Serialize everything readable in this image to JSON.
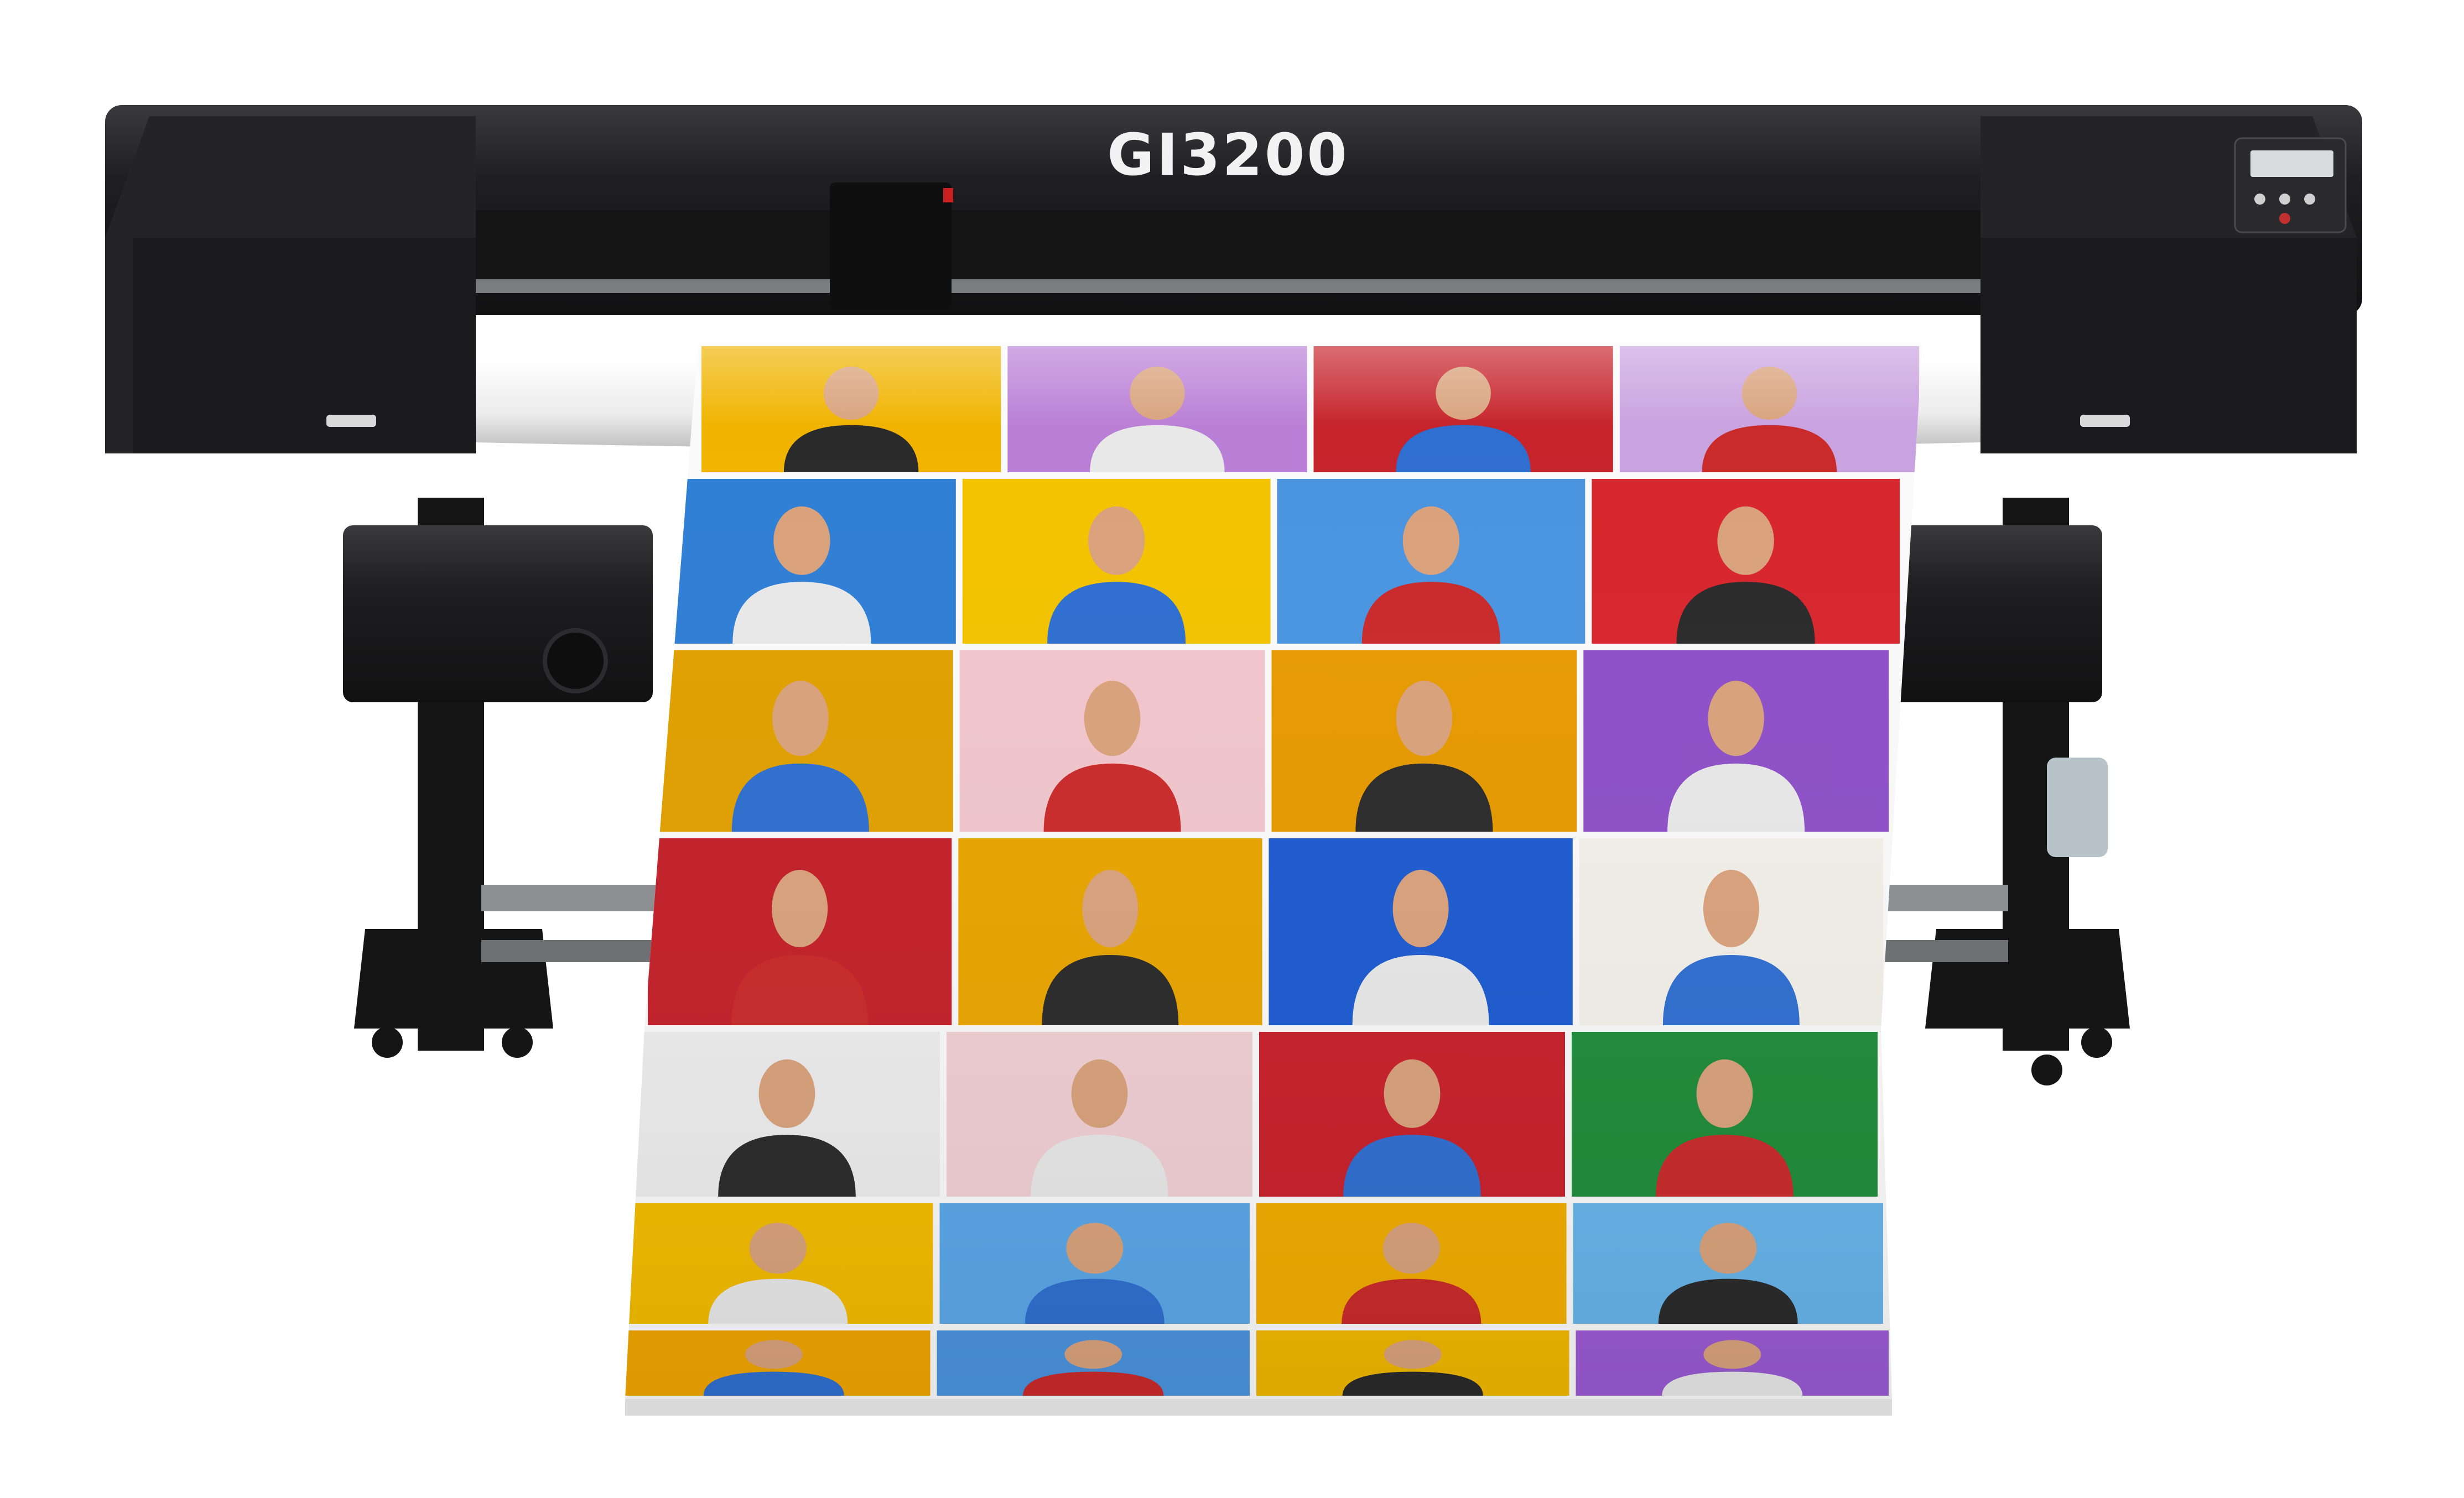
{
  "printer": {
    "model_label": "GI3200",
    "body_color": "#1e1e20",
    "body_highlight": "#2e2e31",
    "platen_color": "#f4f4f4",
    "control_panel": {
      "screen_color": "#d9dcdf",
      "button_count": 4
    }
  },
  "print_media": {
    "rows": 7,
    "columns": 4,
    "tile_colors": [
      [
        "#f0b400",
        "#b97fd6",
        "#c6232b",
        "#c9a2e0"
      ],
      [
        "#2f7fd6",
        "#f3c300",
        "#4a94e0",
        "#d8262d"
      ],
      [
        "#e0a000",
        "#f1c6cc",
        "#e69a00",
        "#8e4fc8"
      ],
      [
        "#c4202a",
        "#e9a500",
        "#1d5bd0",
        "#f3f0ea"
      ],
      [
        "#ededed",
        "#f0cfd3",
        "#c8202b",
        "#1f8c3a"
      ],
      [
        "#f3bc00",
        "#5aa7e8",
        "#f1ad00",
        "#67b4ea"
      ],
      [
        "#f1a500",
        "#4a93de",
        "#f1b800",
        "#9a5ad2"
      ]
    ]
  }
}
